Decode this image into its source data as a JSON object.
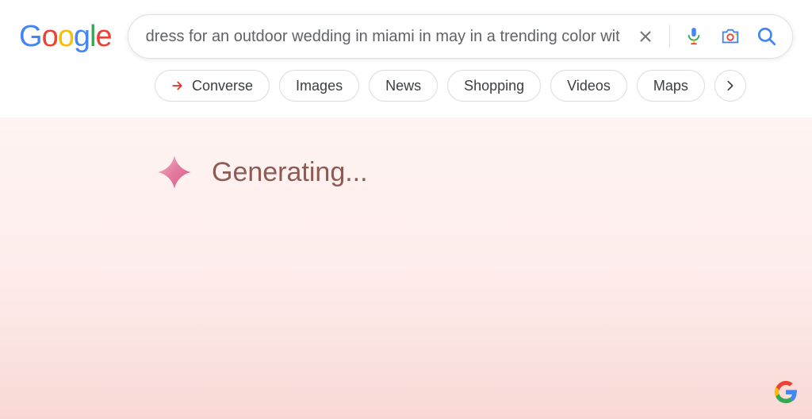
{
  "logo": [
    "G",
    "o",
    "o",
    "g",
    "l",
    "e"
  ],
  "search": {
    "query": "dress for an outdoor wedding in miami in may in a trending color wit"
  },
  "filters": {
    "items": [
      {
        "label": "Converse"
      },
      {
        "label": "Images"
      },
      {
        "label": "News"
      },
      {
        "label": "Shopping"
      },
      {
        "label": "Videos"
      },
      {
        "label": "Maps"
      }
    ]
  },
  "generating": {
    "text": "Generating..."
  }
}
